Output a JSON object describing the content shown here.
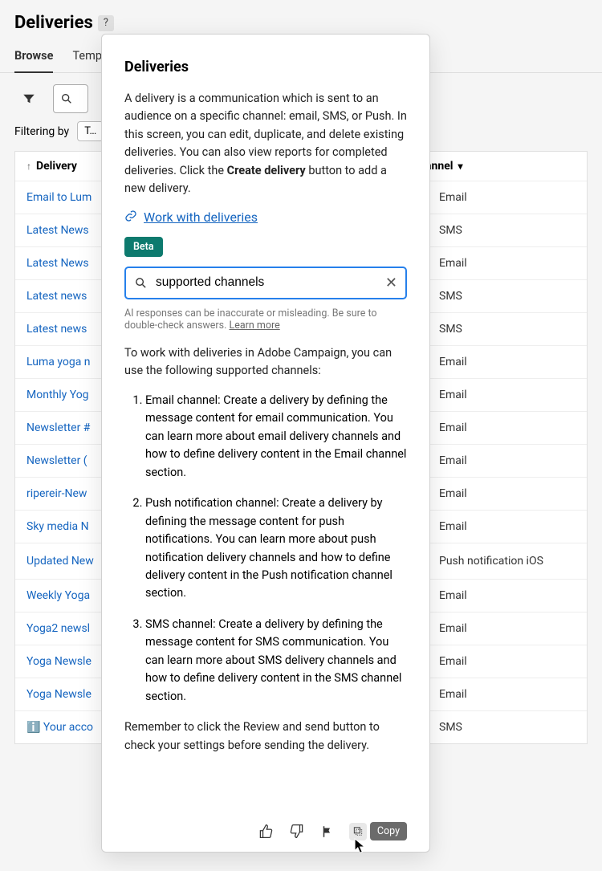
{
  "header": {
    "page_title": "Deliveries",
    "help_icon": "?",
    "tabs": [
      "Browse",
      "Templates"
    ],
    "active_tab_index": 0
  },
  "toolbar": {
    "filtering_label": "Filtering by",
    "template_chip": "T…"
  },
  "grid": {
    "columns": {
      "name": "Delivery",
      "channel": "Channel"
    },
    "rows": [
      {
        "name": "Email to Lum",
        "channel": "Email",
        "icon": "email"
      },
      {
        "name": "Latest News",
        "channel": "SMS",
        "icon": "sms"
      },
      {
        "name": "Latest News",
        "channel": "Email",
        "icon": "email"
      },
      {
        "name": "Latest news",
        "channel": "SMS",
        "icon": "sms"
      },
      {
        "name": "Latest news",
        "channel": "SMS",
        "icon": "sms"
      },
      {
        "name": "Luma yoga n",
        "channel": "Email",
        "icon": "email"
      },
      {
        "name": "Monthly Yog",
        "channel": "Email",
        "icon": "email"
      },
      {
        "name": "Newsletter #",
        "channel": "Email",
        "icon": "email"
      },
      {
        "name": "Newsletter (",
        "channel": "Email",
        "icon": "email"
      },
      {
        "name": "ripereir-New",
        "channel": "Email",
        "icon": "email"
      },
      {
        "name": "Sky media N",
        "channel": "Email",
        "icon": "email"
      },
      {
        "name": "Updated New",
        "channel": "Push notification iOS",
        "icon": "push"
      },
      {
        "name": "Weekly Yoga",
        "channel": "Email",
        "icon": "email"
      },
      {
        "name": "Yoga2 newsl",
        "channel": "Email",
        "icon": "email"
      },
      {
        "name": "Yoga Newsle",
        "channel": "Email",
        "icon": "email"
      },
      {
        "name": "Yoga Newsle",
        "channel": "Email",
        "icon": "email"
      },
      {
        "name": "ℹ️ Your acco",
        "channel": "SMS",
        "icon": "sms"
      }
    ]
  },
  "popup": {
    "title": "Deliveries",
    "desc_pre": "A delivery is a communication which is sent to an audience on a specific channel: email, SMS, or Push. In this screen, you can edit, duplicate, and delete existing deliveries. You can also view reports for completed deliveries. Click the ",
    "desc_bold": "Create delivery",
    "desc_post": " button to add a new delivery.",
    "link_text": "Work with deliveries",
    "beta_label": "Beta",
    "search_value": "supported channels",
    "disclaimer_text": "AI responses can be inaccurate or misleading. Be sure to double-check answers. ",
    "disclaimer_link": "Learn more",
    "answer_intro": "To work with deliveries in Adobe Campaign, you can use the following supported channels:",
    "answer_items": [
      "Email channel: Create a delivery by defining the message content for email communication. You can learn more about email delivery channels and how to define delivery content in the Email channel section.",
      "Push notification channel: Create a delivery by defining the message content for push notifications. You can learn more about push notification delivery channels and how to define delivery content in the Push notification channel section.",
      "SMS channel: Create a delivery by defining the message content for SMS communication. You can learn more about SMS delivery channels and how to define delivery content in the SMS channel section."
    ],
    "answer_outro": "Remember to click the Review and send button to check your settings before sending the delivery.",
    "copy_tooltip": "Copy"
  }
}
